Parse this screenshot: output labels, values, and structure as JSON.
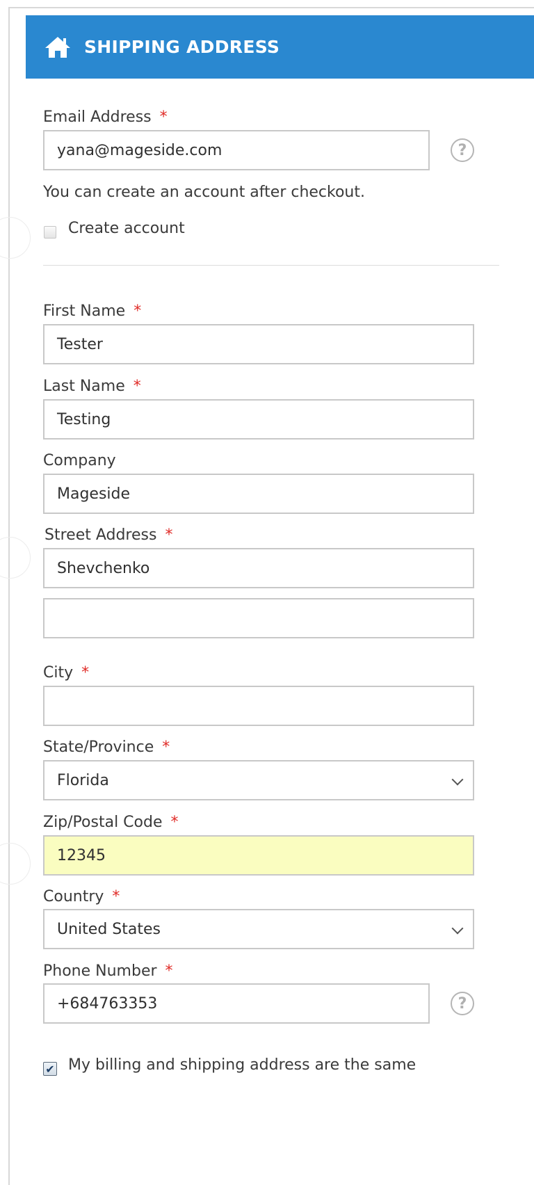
{
  "header": {
    "title": "SHIPPING ADDRESS",
    "icon": "home-icon"
  },
  "email": {
    "label": "Email Address",
    "required_mark": "*",
    "value": "yana@mageside.com",
    "help_icon": "?",
    "note": "You can create an account after checkout.",
    "create_account_label": "Create account",
    "create_account_checked": false
  },
  "fields": {
    "first_name": {
      "label": "First Name",
      "required_mark": "*",
      "value": "Tester"
    },
    "last_name": {
      "label": "Last Name",
      "required_mark": "*",
      "value": "Testing"
    },
    "company": {
      "label": "Company",
      "value": "Mageside"
    },
    "street": {
      "label": "Street Address",
      "required_mark": "*",
      "line1": "Shevchenko",
      "line2": ""
    },
    "city": {
      "label": "City",
      "required_mark": "*",
      "value": ""
    },
    "state": {
      "label": "State/Province",
      "required_mark": "*",
      "value": "Florida"
    },
    "zip": {
      "label": "Zip/Postal Code",
      "required_mark": "*",
      "value": "12345"
    },
    "country": {
      "label": "Country",
      "required_mark": "*",
      "value": "United States"
    },
    "phone": {
      "label": "Phone Number",
      "required_mark": "*",
      "value": "+684763353",
      "help_icon": "?"
    }
  },
  "billing_same": {
    "label": "My billing and shipping address are the same",
    "checked": true
  },
  "colors": {
    "header_bg": "#2a88d0",
    "required": "#e02b27",
    "highlight_field": "#fafdc0"
  }
}
